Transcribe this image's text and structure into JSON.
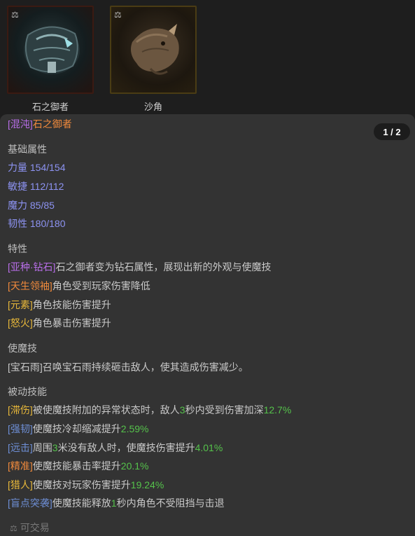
{
  "pets": [
    {
      "name": "石之御者",
      "badge_icon": "balance-scale-icon"
    },
    {
      "name": "沙角",
      "badge_icon": "balance-scale-icon"
    }
  ],
  "pager": {
    "label": "1 / 2"
  },
  "title": {
    "prefix": "[混沌]",
    "name": "石之御者"
  },
  "base_attrs": {
    "heading": "基础属性",
    "items": [
      "力量 154/154",
      "敏捷 112/112",
      "魔力 85/85",
      "韧性 180/180"
    ]
  },
  "traits": {
    "heading": "特性",
    "items": [
      {
        "tag": "[亚种·钻石]",
        "text": "石之御者变为钻石属性，展现出新的外观与使魔技"
      },
      {
        "tag": "[天生领袖]",
        "text": "角色受到玩家伤害降低"
      },
      {
        "tag": "[元素]",
        "text": "角色技能伤害提升"
      },
      {
        "tag": "[怒火]",
        "text": "角色暴击伤害提升"
      }
    ]
  },
  "skill": {
    "heading": "使魔技",
    "tag": "[宝石雨]",
    "text": "召唤宝石雨持续砸击敌人，使其造成伤害减少。"
  },
  "passives": {
    "heading": "被动技能",
    "items": [
      {
        "tag": "[滞伤]",
        "t1": "被使魔技附加的异常状态时，敌人",
        "n1": "3",
        "t2": "秒内受到伤害加深",
        "n2": "12.7%"
      },
      {
        "tag": "[强韧]",
        "t1": "使魔技冷却缩减提升",
        "n1": "2.59%"
      },
      {
        "tag": "[远击]",
        "t1": "周围",
        "n1": "3",
        "t2": "米没有敌人时，使魔技伤害提升",
        "n2": "4.01%"
      },
      {
        "tag": "[精准]",
        "t1": "使魔技能暴击率提升",
        "n1": "20.1%"
      },
      {
        "tag": "[猎人]",
        "t1": "使魔技对玩家伤害提升",
        "n1": "19.24%"
      },
      {
        "tag": "[盲点突袭]",
        "t1": "使魔技能释放",
        "n1": "1",
        "t2": "秒内角色不受阻挡与击退"
      }
    ]
  },
  "footer": {
    "icon": "balance-scale-icon",
    "label": "可交易"
  },
  "colors": {
    "chaos": "#b86ee8",
    "orange_tag": "#f08a3c",
    "gold_tag": "#e8b83a",
    "blue_tag": "#6e8fd6",
    "stat": "#8d93f2",
    "number_green": "#55c24b"
  }
}
